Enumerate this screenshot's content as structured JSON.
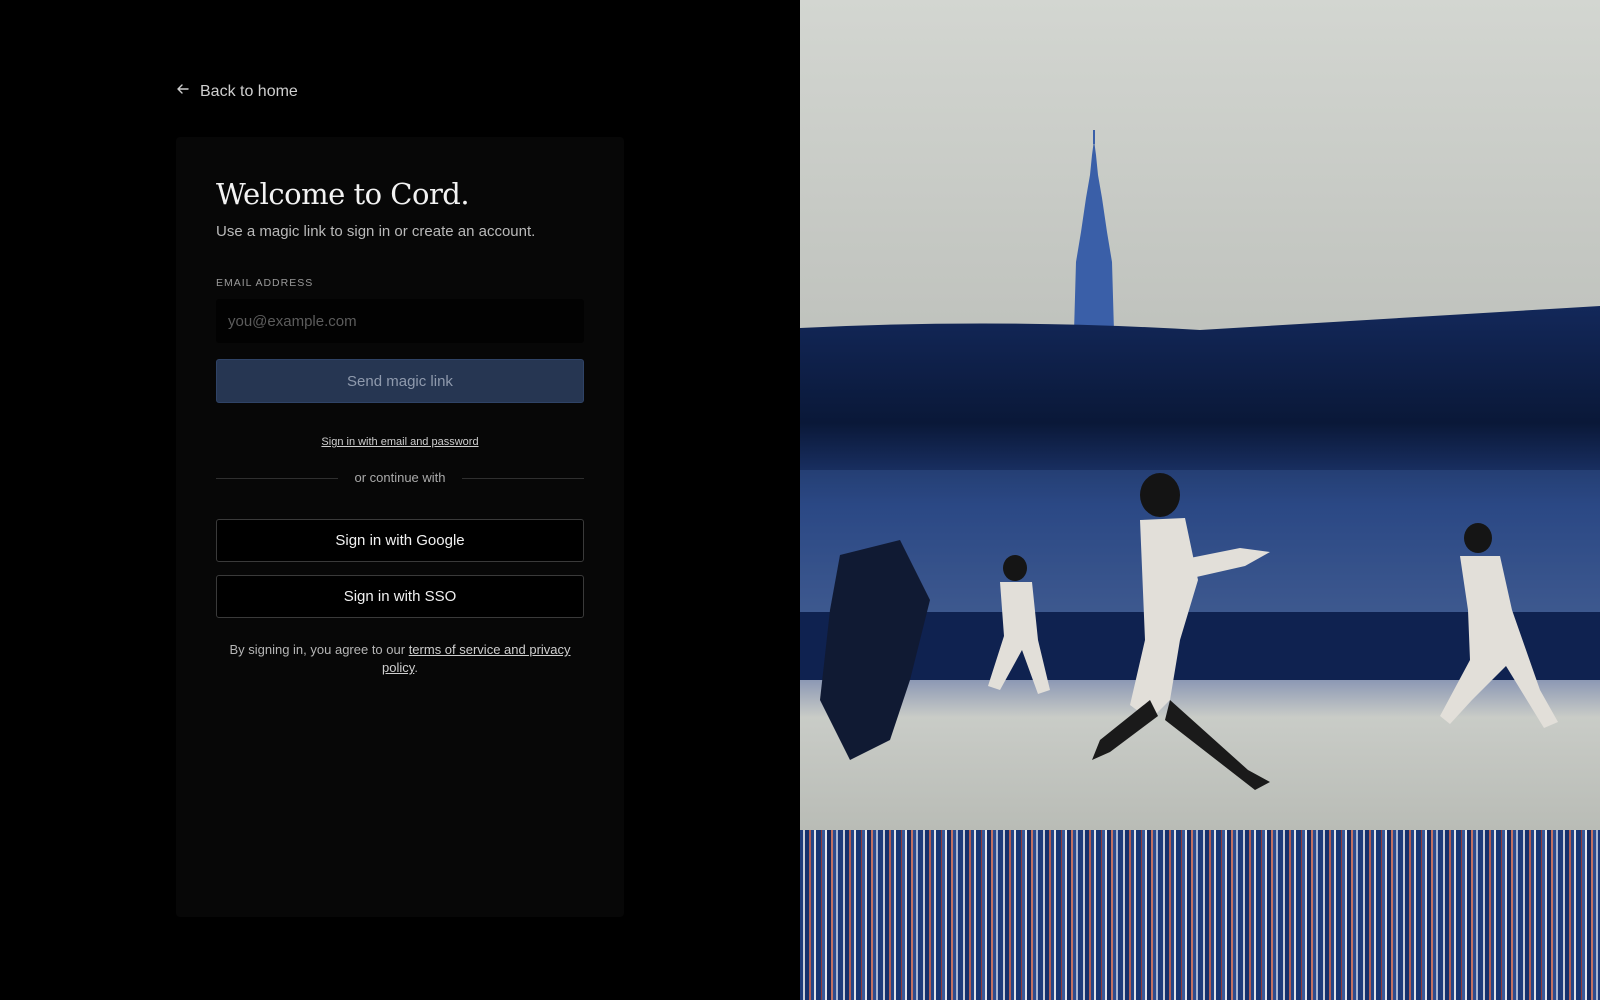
{
  "nav": {
    "back_label": "Back to home",
    "back_icon": "arrow-left-icon"
  },
  "card": {
    "title": "Welcome to Cord.",
    "subtitle": "Use a magic link to sign in or create an account.",
    "email_label": "EMAIL ADDRESS",
    "email_placeholder": "you@example.com",
    "email_value": "",
    "magic_button": "Send magic link",
    "password_link": "Sign in with email and password",
    "divider_text": "or continue with",
    "google_button": "Sign in with Google",
    "sso_button": "Sign in with SSO",
    "legal_prefix": "By signing in, you agree to our ",
    "legal_link": "terms of service and privacy policy",
    "legal_suffix": "."
  },
  "colors": {
    "background": "#000000",
    "card": "#070707",
    "magic_button_bg": "#263652",
    "photo_blue": "#1c3570",
    "photo_red": "#b3564a"
  }
}
